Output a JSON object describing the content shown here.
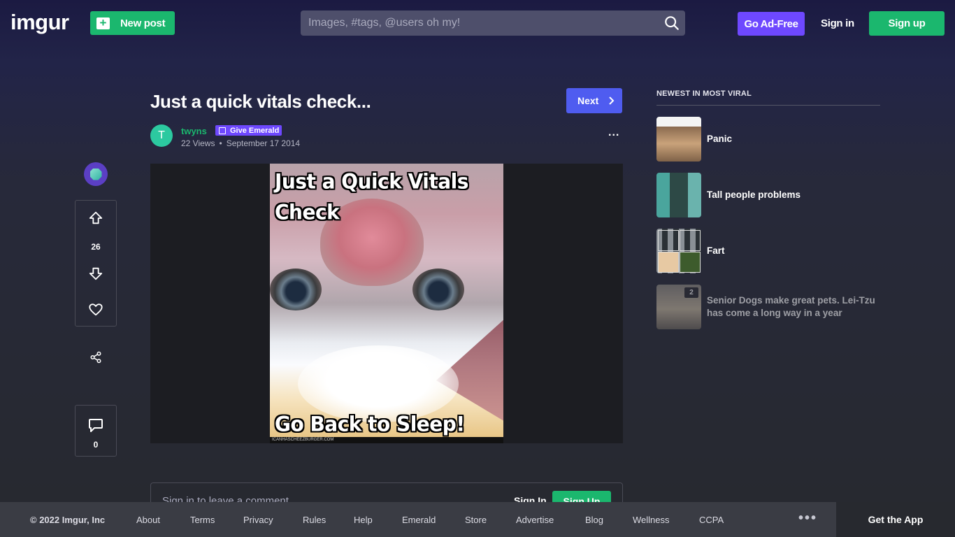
{
  "header": {
    "logo": "imgur",
    "new_post_label": "New post",
    "search_placeholder": "Images, #tags, @users oh my!",
    "ad_free_label": "Go Ad-Free",
    "sign_in_label": "Sign in",
    "sign_up_label": "Sign up"
  },
  "post": {
    "title": "Just a quick vitals check...",
    "next_label": "Next",
    "author_initial": "T",
    "author": "twyns",
    "give_emerald_label": "Give Emerald",
    "views": "22 Views",
    "date": "September 17 2014",
    "votes": "26",
    "comments": "0",
    "image": {
      "caption_top": "Just a Quick Vitals Check",
      "caption_bottom": "Go Back to Sleep!",
      "watermark": "ICANHASCHEEZBURGER.COM"
    }
  },
  "comment_box": {
    "placeholder": "Sign in to leave a comment",
    "sign_in_label": "Sign In",
    "sign_up_label": "Sign Up"
  },
  "sidebar": {
    "heading": "NEWEST IN MOST VIRAL",
    "items": [
      {
        "title": "Panic",
        "badge": ""
      },
      {
        "title": "Tall people problems",
        "badge": ""
      },
      {
        "title": "Fart",
        "badge": ""
      },
      {
        "title": "Senior Dogs make great pets. Lei-Tzu has come a long way in a year",
        "badge": "2"
      }
    ]
  },
  "footer": {
    "copyright": "© 2022 Imgur, Inc",
    "links": [
      "About",
      "Terms",
      "Privacy",
      "Rules",
      "Help",
      "Emerald",
      "Store",
      "Advertise",
      "Blog",
      "Wellness",
      "CCPA"
    ],
    "get_app_label": "Get the App"
  },
  "colors": {
    "brand_green": "#1bb76e",
    "ad_free_purple": "#6e48ff",
    "next_blue": "#4f5cf0"
  }
}
